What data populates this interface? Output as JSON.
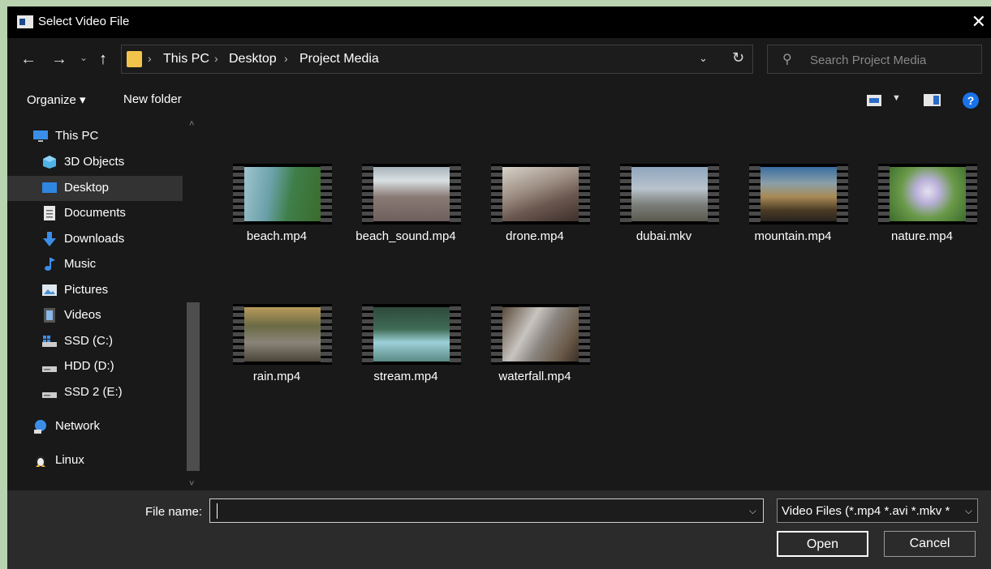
{
  "window": {
    "title": "Select Video File",
    "close_glyph": "✕"
  },
  "nav": {
    "back": "←",
    "forward": "→",
    "recent": "⌄",
    "up": "↑",
    "breadcrumbs": [
      "This PC",
      "Desktop",
      "Project Media"
    ],
    "separator": "›",
    "dropdown": "⌄",
    "refresh": "↻",
    "search_placeholder": "Search Project Media",
    "search_icon": "⚲"
  },
  "toolbar": {
    "organize": "Organize ▾",
    "new_folder": "New folder",
    "view_dd": "▼",
    "help": "?"
  },
  "sidebar": {
    "items": [
      {
        "label": "This PC",
        "icon": "monitor-icon"
      },
      {
        "label": "3D Objects",
        "icon": "cube-icon"
      },
      {
        "label": "Desktop",
        "icon": "desktop-icon",
        "selected": true
      },
      {
        "label": "Documents",
        "icon": "document-icon"
      },
      {
        "label": "Downloads",
        "icon": "download-icon"
      },
      {
        "label": "Music",
        "icon": "music-note-icon"
      },
      {
        "label": "Pictures",
        "icon": "picture-icon"
      },
      {
        "label": "Videos",
        "icon": "film-icon"
      },
      {
        "label": "SSD (C:)",
        "icon": "windows-drive-icon"
      },
      {
        "label": "HDD (D:)",
        "icon": "drive-icon"
      },
      {
        "label": "SSD 2 (E:)",
        "icon": "drive-icon"
      },
      {
        "label": "Network",
        "icon": "network-icon"
      },
      {
        "label": "Linux",
        "icon": "penguin-icon"
      }
    ],
    "scroll_up": "˄",
    "scroll_down": "˅"
  },
  "files": [
    {
      "name": "beach.mp4"
    },
    {
      "name": "beach_sound.mp4"
    },
    {
      "name": "drone.mp4"
    },
    {
      "name": "dubai.mkv"
    },
    {
      "name": "mountain.mp4"
    },
    {
      "name": "nature.mp4"
    },
    {
      "name": "rain.mp4"
    },
    {
      "name": "stream.mp4"
    },
    {
      "name": "waterfall.mp4"
    }
  ],
  "bottom": {
    "file_name_label": "File name:",
    "file_name_value": "",
    "dropdown_glyph": "⌵",
    "filter": "Video Files (*.mp4 *.avi *.mkv *",
    "open": "Open",
    "cancel": "Cancel"
  },
  "colors": {
    "background": "#191919",
    "selected": "#333333",
    "accent": "#1a73e8",
    "folder": "#f3c44c"
  }
}
